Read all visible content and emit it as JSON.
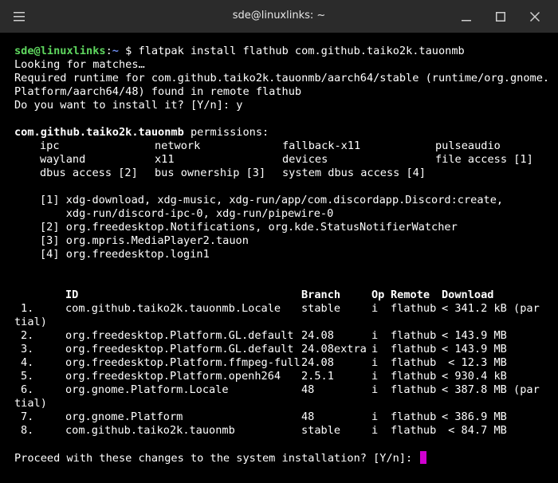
{
  "window": {
    "title": "sde@linuxlinks: ~"
  },
  "prompt": {
    "user_host": "sde@linuxlinks",
    "colon": ":",
    "path": "~",
    "symbol": "$",
    "command": "flatpak install flathub com.github.taiko2k.tauonmb"
  },
  "output": {
    "looking": "Looking for matches…",
    "required_1": "Required runtime for com.github.taiko2k.tauonmb/aarch64/stable (runtime/org.gnome.",
    "required_2": "Platform/aarch64/48) found in remote flathub",
    "install_q": "Do you want to install it? [Y/n]: y"
  },
  "permissions": {
    "app_id": "com.github.taiko2k.tauonmb",
    "label": " permissions:",
    "rows": [
      [
        "ipc",
        "network",
        "fallback-x11",
        "pulseaudio"
      ],
      [
        "wayland",
        "x11",
        "devices",
        "file access [1]"
      ],
      [
        "dbus access [2]",
        "bus ownership [3]",
        "system dbus access [4]",
        ""
      ]
    ],
    "notes": [
      "[1] xdg-download, xdg-music, xdg-run/app/com.discordapp.Discord:create,",
      "    xdg-run/discord-ipc-0, xdg-run/pipewire-0",
      "[2] org.freedesktop.Notifications, org.kde.StatusNotifierWatcher",
      "[3] org.mpris.MediaPlayer2.tauon",
      "[4] org.freedesktop.login1"
    ]
  },
  "table": {
    "headers": {
      "id": "ID",
      "branch": "Branch",
      "op": "Op",
      "remote": "Remote",
      "download": "Download"
    },
    "rows": [
      {
        "num": "1.",
        "id": "com.github.taiko2k.tauonmb.Locale",
        "branch": "stable",
        "op": "i",
        "remote": "flathub",
        "download": "< 341.2 kB (par",
        "wrap": "tial)"
      },
      {
        "num": "2.",
        "id": "org.freedesktop.Platform.GL.default",
        "branch": "24.08",
        "op": "i",
        "remote": "flathub",
        "download": "< 143.9 MB"
      },
      {
        "num": "3.",
        "id": "org.freedesktop.Platform.GL.default",
        "branch": "24.08extra",
        "op": "i",
        "remote": "flathub",
        "download": "< 143.9 MB"
      },
      {
        "num": "4.",
        "id": "org.freedesktop.Platform.ffmpeg-full",
        "branch": "24.08",
        "op": "i",
        "remote": "flathub",
        "download": " < 12.3 MB"
      },
      {
        "num": "5.",
        "id": "org.freedesktop.Platform.openh264",
        "branch": "2.5.1",
        "op": "i",
        "remote": "flathub",
        "download": "< 930.4 kB"
      },
      {
        "num": "6.",
        "id": "org.gnome.Platform.Locale",
        "branch": "48",
        "op": "i",
        "remote": "flathub",
        "download": "< 387.8 MB (par",
        "wrap": "tial)"
      },
      {
        "num": "7.",
        "id": "org.gnome.Platform",
        "branch": "48",
        "op": "i",
        "remote": "flathub",
        "download": "< 386.9 MB"
      },
      {
        "num": "8.",
        "id": "com.github.taiko2k.tauonmb",
        "branch": "stable",
        "op": "i",
        "remote": "flathub",
        "download": " < 84.7 MB"
      }
    ]
  },
  "proceed_prompt": "Proceed with these changes to the system installation? [Y/n]: ",
  "colors": {
    "background": "#000000",
    "text": "#ffffff",
    "prompt_user": "#5fd75f",
    "prompt_path": "#6f8ef0",
    "cursor": "#d000d0",
    "titlebar": "#2b2b2b"
  }
}
